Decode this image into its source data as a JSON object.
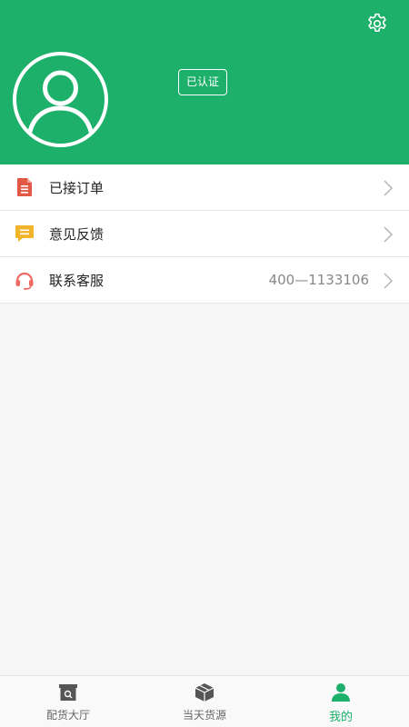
{
  "colors": {
    "primary": "#1db06b",
    "order_icon": "#e35745",
    "feedback_icon": "#f2b42a",
    "service_icon": "#ee6b63",
    "nav_inactive": "#555555"
  },
  "header": {
    "settings_icon": "gear-icon",
    "avatar_icon": "user-avatar-icon",
    "verified_label": "已认证"
  },
  "menu": {
    "items": [
      {
        "icon": "document-icon",
        "label": "已接订单",
        "value": ""
      },
      {
        "icon": "message-icon",
        "label": "意见反馈",
        "value": ""
      },
      {
        "icon": "headset-icon",
        "label": "联系客服",
        "value": "400—1133106"
      }
    ]
  },
  "bottom_nav": {
    "items": [
      {
        "icon": "warehouse-icon",
        "label": "配货大厅",
        "active": false
      },
      {
        "icon": "package-icon",
        "label": "当天货源",
        "active": false
      },
      {
        "icon": "person-icon",
        "label": "我的",
        "active": true
      }
    ]
  }
}
